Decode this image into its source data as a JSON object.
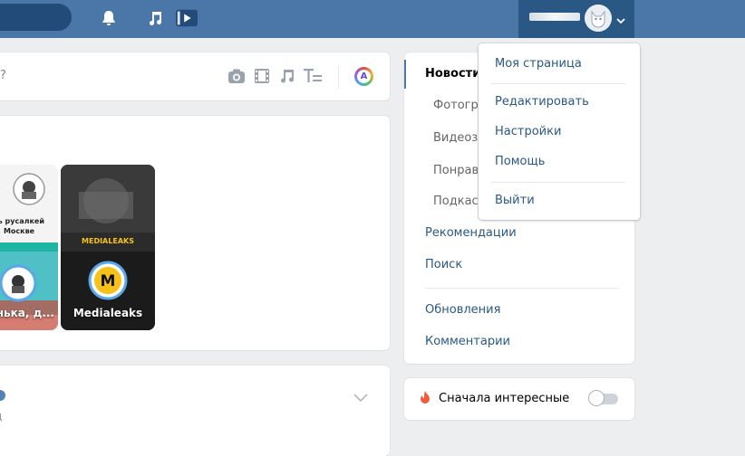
{
  "header": {
    "icons": [
      "bell-icon",
      "music-icon",
      "video-icon"
    ],
    "accent": "#4a76a8",
    "accent_dark": "#2a5885"
  },
  "post_box": {
    "placeholder": "?",
    "tools": [
      "camera-icon",
      "film-icon",
      "music-note-icon",
      "text-icon"
    ],
    "color_button": "A"
  },
  "stories": [
    {
      "name": "нька, д...",
      "title": "ть русалкей\nМоскве"
    },
    {
      "name": "Medialeaks",
      "logo": "MEDIALEAKS",
      "badge": "M"
    }
  ],
  "feed_post": {
    "subtitle": "д"
  },
  "side_nav": {
    "items": [
      {
        "label": "Новости"
      },
      {
        "label": "Фотогра"
      },
      {
        "label": "Видеоз"
      },
      {
        "label": "Понрав"
      },
      {
        "label": "Подкас"
      },
      {
        "label": "Рекомендации"
      },
      {
        "label": "Поиск"
      },
      {
        "label": "Обновления"
      },
      {
        "label": "Комментарии"
      }
    ]
  },
  "interesting": {
    "label": "Сначала интересные"
  },
  "dropdown": {
    "items": [
      {
        "label": "Моя страница"
      },
      {
        "label": "Редактировать"
      },
      {
        "label": "Настройки"
      },
      {
        "label": "Помощь"
      },
      {
        "label": "Выйти"
      }
    ]
  }
}
